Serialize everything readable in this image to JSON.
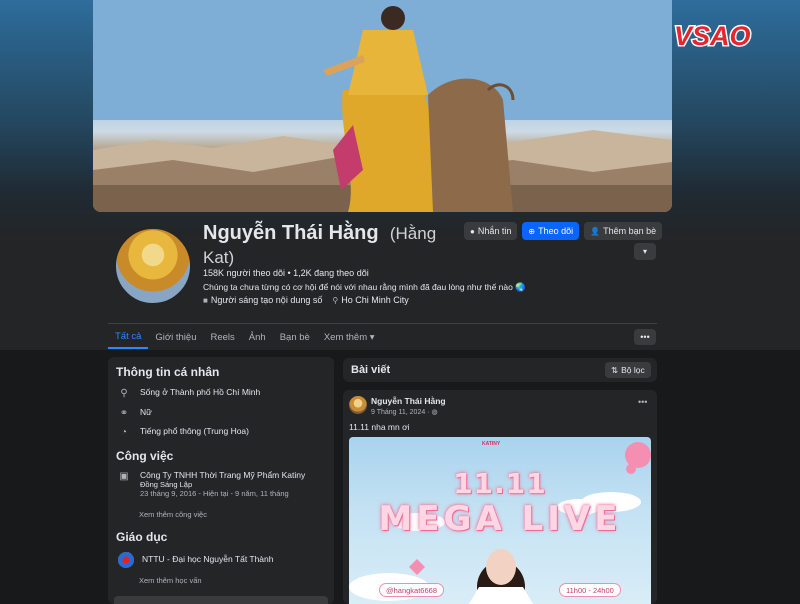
{
  "watermark": {
    "text": "VSAO"
  },
  "profile": {
    "name": "Nguyễn Thái Hằng",
    "alias_line1": "(Hằng",
    "alias_line2": "Kat)",
    "followers": "158K người theo dõi • 1,2K đang theo dõi",
    "bio": "Chúng ta chưa từng có cơ hội để nói với nhau rằng mình đã đau lòng như thế nào 🌏",
    "tag_creator": "Người sáng tạo nội dung số",
    "tag_location": "Ho Chi Minh City"
  },
  "actions": {
    "message": "Nhắn tin",
    "follow": "Theo dõi",
    "add_friend": "Thêm bạn bè"
  },
  "tabs": [
    "Tất cả",
    "Giới thiệu",
    "Reels",
    "Ảnh",
    "Bạn bè",
    "Xem thêm ▾"
  ],
  "intro": {
    "title": "Thông tin cá nhân",
    "lives_in": "Sống ở Thành phố Hồ Chí Minh",
    "gender": "Nữ",
    "language": "Tiếng phổ thông (Trung Hoa)",
    "work_title": "Công việc",
    "work_company": "Công Ty TNHH Thời Trang Mỹ Phẩm Katiny",
    "work_role": "Đồng Sáng Lập",
    "work_dates": "23 tháng 9, 2016 - Hiện tại - 9 năm, 11 tháng",
    "work_more": "Xem thêm công việc",
    "edu_title": "Giáo dục",
    "edu_school": "NTTU - Đại học Nguyễn Tất Thành",
    "edu_more": "Xem thêm học vấn"
  },
  "posts": {
    "title": "Bài viết",
    "filter": "Bộ lọc",
    "post": {
      "author": "Nguyễn Thái Hằng",
      "date": "9 Tháng 11, 2024 · ",
      "text": "11.11 nha mn ơi",
      "poster_brand": "KATINY",
      "poster_line1": "11.11",
      "poster_line2": "MEGA LIVE",
      "poster_handle": "@hangkat6668",
      "poster_time": "11h00 - 24h00"
    }
  },
  "colors": {
    "accent": "#0866ff",
    "tab_active": "#2d88ff",
    "card": "#242526",
    "background": "#18191a",
    "watermark_red": "#e4262f"
  }
}
